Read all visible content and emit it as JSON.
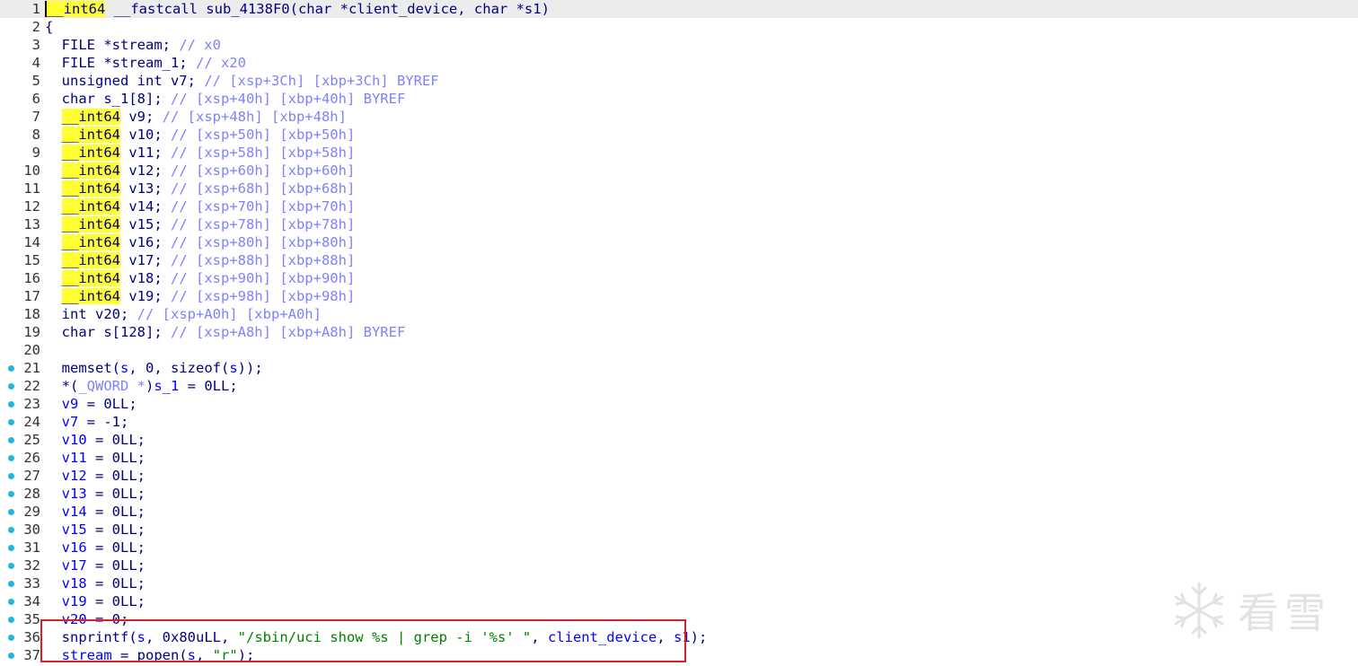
{
  "editor": {
    "breakpoint_color": "#20b7e0",
    "highlight_box_color": "#d9202a",
    "lines": [
      {
        "n": "1",
        "bp": false,
        "current": true,
        "tokens": [
          {
            "t": "__int64",
            "c": "y",
            "cursor": true
          },
          {
            "t": " __fastcall sub_4138F0(char *client_device, char *s1)",
            "c": "k"
          }
        ]
      },
      {
        "n": "2",
        "bp": false,
        "tokens": [
          {
            "t": "{",
            "c": "p"
          }
        ]
      },
      {
        "n": "3",
        "bp": false,
        "tokens": [
          {
            "t": "  FILE *stream; ",
            "c": "k"
          },
          {
            "t": "// x0",
            "c": "c"
          }
        ]
      },
      {
        "n": "4",
        "bp": false,
        "tokens": [
          {
            "t": "  FILE *stream_1; ",
            "c": "k"
          },
          {
            "t": "// x20",
            "c": "c"
          }
        ]
      },
      {
        "n": "5",
        "bp": false,
        "tokens": [
          {
            "t": "  unsigned int v7; ",
            "c": "k"
          },
          {
            "t": "// [xsp+3Ch] [xbp+3Ch] BYREF",
            "c": "c"
          }
        ]
      },
      {
        "n": "6",
        "bp": false,
        "tokens": [
          {
            "t": "  char s_1[8]; ",
            "c": "k"
          },
          {
            "t": "// [xsp+40h] [xbp+40h] BYREF",
            "c": "c"
          }
        ]
      },
      {
        "n": "7",
        "bp": false,
        "tokens": [
          {
            "t": "  ",
            "c": "k"
          },
          {
            "t": "__int64",
            "c": "y"
          },
          {
            "t": " v9; ",
            "c": "k"
          },
          {
            "t": "// [xsp+48h] [xbp+48h]",
            "c": "c"
          }
        ]
      },
      {
        "n": "8",
        "bp": false,
        "tokens": [
          {
            "t": "  ",
            "c": "k"
          },
          {
            "t": "__int64",
            "c": "y"
          },
          {
            "t": " v10; ",
            "c": "k"
          },
          {
            "t": "// [xsp+50h] [xbp+50h]",
            "c": "c"
          }
        ]
      },
      {
        "n": "9",
        "bp": false,
        "tokens": [
          {
            "t": "  ",
            "c": "k"
          },
          {
            "t": "__int64",
            "c": "y"
          },
          {
            "t": " v11; ",
            "c": "k"
          },
          {
            "t": "// [xsp+58h] [xbp+58h]",
            "c": "c"
          }
        ]
      },
      {
        "n": "10",
        "bp": false,
        "tokens": [
          {
            "t": "  ",
            "c": "k"
          },
          {
            "t": "__int64",
            "c": "y"
          },
          {
            "t": " v12; ",
            "c": "k"
          },
          {
            "t": "// [xsp+60h] [xbp+60h]",
            "c": "c"
          }
        ]
      },
      {
        "n": "11",
        "bp": false,
        "tokens": [
          {
            "t": "  ",
            "c": "k"
          },
          {
            "t": "__int64",
            "c": "y"
          },
          {
            "t": " v13; ",
            "c": "k"
          },
          {
            "t": "// [xsp+68h] [xbp+68h]",
            "c": "c"
          }
        ]
      },
      {
        "n": "12",
        "bp": false,
        "tokens": [
          {
            "t": "  ",
            "c": "k"
          },
          {
            "t": "__int64",
            "c": "y"
          },
          {
            "t": " v14; ",
            "c": "k"
          },
          {
            "t": "// [xsp+70h] [xbp+70h]",
            "c": "c"
          }
        ]
      },
      {
        "n": "13",
        "bp": false,
        "tokens": [
          {
            "t": "  ",
            "c": "k"
          },
          {
            "t": "__int64",
            "c": "y"
          },
          {
            "t": " v15; ",
            "c": "k"
          },
          {
            "t": "// [xsp+78h] [xbp+78h]",
            "c": "c"
          }
        ]
      },
      {
        "n": "14",
        "bp": false,
        "tokens": [
          {
            "t": "  ",
            "c": "k"
          },
          {
            "t": "__int64",
            "c": "y"
          },
          {
            "t": " v16; ",
            "c": "k"
          },
          {
            "t": "// [xsp+80h] [xbp+80h]",
            "c": "c"
          }
        ]
      },
      {
        "n": "15",
        "bp": false,
        "tokens": [
          {
            "t": "  ",
            "c": "k"
          },
          {
            "t": "__int64",
            "c": "y"
          },
          {
            "t": " v17; ",
            "c": "k"
          },
          {
            "t": "// [xsp+88h] [xbp+88h]",
            "c": "c"
          }
        ]
      },
      {
        "n": "16",
        "bp": false,
        "tokens": [
          {
            "t": "  ",
            "c": "k"
          },
          {
            "t": "__int64",
            "c": "y"
          },
          {
            "t": " v18; ",
            "c": "k"
          },
          {
            "t": "// [xsp+90h] [xbp+90h]",
            "c": "c"
          }
        ]
      },
      {
        "n": "17",
        "bp": false,
        "tokens": [
          {
            "t": "  ",
            "c": "k"
          },
          {
            "t": "__int64",
            "c": "y"
          },
          {
            "t": " v19; ",
            "c": "k"
          },
          {
            "t": "// [xsp+98h] [xbp+98h]",
            "c": "c"
          }
        ]
      },
      {
        "n": "18",
        "bp": false,
        "tokens": [
          {
            "t": "  int v20; ",
            "c": "k"
          },
          {
            "t": "// [xsp+A0h] [xbp+A0h]",
            "c": "c"
          }
        ]
      },
      {
        "n": "19",
        "bp": false,
        "tokens": [
          {
            "t": "  char s[128]; ",
            "c": "k"
          },
          {
            "t": "// [xsp+A8h] [xbp+A8h] BYREF",
            "c": "c"
          }
        ]
      },
      {
        "n": "20",
        "bp": false,
        "tokens": []
      },
      {
        "n": "21",
        "bp": true,
        "tokens": [
          {
            "t": "  memset(",
            "c": "f"
          },
          {
            "t": "s",
            "c": "v"
          },
          {
            "t": ", 0, sizeof(",
            "c": "p"
          },
          {
            "t": "s",
            "c": "v"
          },
          {
            "t": "));",
            "c": "p"
          }
        ]
      },
      {
        "n": "22",
        "bp": true,
        "tokens": [
          {
            "t": "  *(",
            "c": "p"
          },
          {
            "t": "_QWORD *",
            "c": "c"
          },
          {
            "t": ")",
            "c": "p"
          },
          {
            "t": "s_1",
            "c": "v"
          },
          {
            "t": " = 0LL;",
            "c": "p"
          }
        ]
      },
      {
        "n": "23",
        "bp": true,
        "tokens": [
          {
            "t": "  ",
            "c": "p"
          },
          {
            "t": "v9",
            "c": "v"
          },
          {
            "t": " = 0LL;",
            "c": "p"
          }
        ]
      },
      {
        "n": "24",
        "bp": true,
        "tokens": [
          {
            "t": "  ",
            "c": "p"
          },
          {
            "t": "v7",
            "c": "v"
          },
          {
            "t": " = -1;",
            "c": "p"
          }
        ]
      },
      {
        "n": "25",
        "bp": true,
        "tokens": [
          {
            "t": "  ",
            "c": "p"
          },
          {
            "t": "v10",
            "c": "v"
          },
          {
            "t": " = 0LL;",
            "c": "p"
          }
        ]
      },
      {
        "n": "26",
        "bp": true,
        "tokens": [
          {
            "t": "  ",
            "c": "p"
          },
          {
            "t": "v11",
            "c": "v"
          },
          {
            "t": " = 0LL;",
            "c": "p"
          }
        ]
      },
      {
        "n": "27",
        "bp": true,
        "tokens": [
          {
            "t": "  ",
            "c": "p"
          },
          {
            "t": "v12",
            "c": "v"
          },
          {
            "t": " = 0LL;",
            "c": "p"
          }
        ]
      },
      {
        "n": "28",
        "bp": true,
        "tokens": [
          {
            "t": "  ",
            "c": "p"
          },
          {
            "t": "v13",
            "c": "v"
          },
          {
            "t": " = 0LL;",
            "c": "p"
          }
        ]
      },
      {
        "n": "29",
        "bp": true,
        "tokens": [
          {
            "t": "  ",
            "c": "p"
          },
          {
            "t": "v14",
            "c": "v"
          },
          {
            "t": " = 0LL;",
            "c": "p"
          }
        ]
      },
      {
        "n": "30",
        "bp": true,
        "tokens": [
          {
            "t": "  ",
            "c": "p"
          },
          {
            "t": "v15",
            "c": "v"
          },
          {
            "t": " = 0LL;",
            "c": "p"
          }
        ]
      },
      {
        "n": "31",
        "bp": true,
        "tokens": [
          {
            "t": "  ",
            "c": "p"
          },
          {
            "t": "v16",
            "c": "v"
          },
          {
            "t": " = 0LL;",
            "c": "p"
          }
        ]
      },
      {
        "n": "32",
        "bp": true,
        "tokens": [
          {
            "t": "  ",
            "c": "p"
          },
          {
            "t": "v17",
            "c": "v"
          },
          {
            "t": " = 0LL;",
            "c": "p"
          }
        ]
      },
      {
        "n": "33",
        "bp": true,
        "tokens": [
          {
            "t": "  ",
            "c": "p"
          },
          {
            "t": "v18",
            "c": "v"
          },
          {
            "t": " = 0LL;",
            "c": "p"
          }
        ]
      },
      {
        "n": "34",
        "bp": true,
        "tokens": [
          {
            "t": "  ",
            "c": "p"
          },
          {
            "t": "v19",
            "c": "v"
          },
          {
            "t": " = 0LL;",
            "c": "p"
          }
        ]
      },
      {
        "n": "35",
        "bp": true,
        "tokens": [
          {
            "t": "  ",
            "c": "p"
          },
          {
            "t": "v20",
            "c": "v"
          },
          {
            "t": " = 0;",
            "c": "p"
          }
        ]
      },
      {
        "n": "36",
        "bp": true,
        "tokens": [
          {
            "t": "  snprintf(",
            "c": "f"
          },
          {
            "t": "s",
            "c": "v"
          },
          {
            "t": ", 0x80uLL, ",
            "c": "p"
          },
          {
            "t": "\"/sbin/uci show %s | grep -i '%s' \"",
            "c": "s"
          },
          {
            "t": ", ",
            "c": "p"
          },
          {
            "t": "client_device",
            "c": "v"
          },
          {
            "t": ", ",
            "c": "p"
          },
          {
            "t": "s1",
            "c": "v"
          },
          {
            "t": ");",
            "c": "p"
          }
        ]
      },
      {
        "n": "37",
        "bp": true,
        "tokens": [
          {
            "t": "  ",
            "c": "p"
          },
          {
            "t": "stream",
            "c": "v"
          },
          {
            "t": " = popen(",
            "c": "p"
          },
          {
            "t": "s",
            "c": "v"
          },
          {
            "t": ", ",
            "c": "p"
          },
          {
            "t": "\"r\"",
            "c": "s"
          },
          {
            "t": ");",
            "c": "p"
          }
        ]
      }
    ]
  },
  "watermark": {
    "text": "看雪",
    "icon": "snowflake-logo-icon"
  }
}
